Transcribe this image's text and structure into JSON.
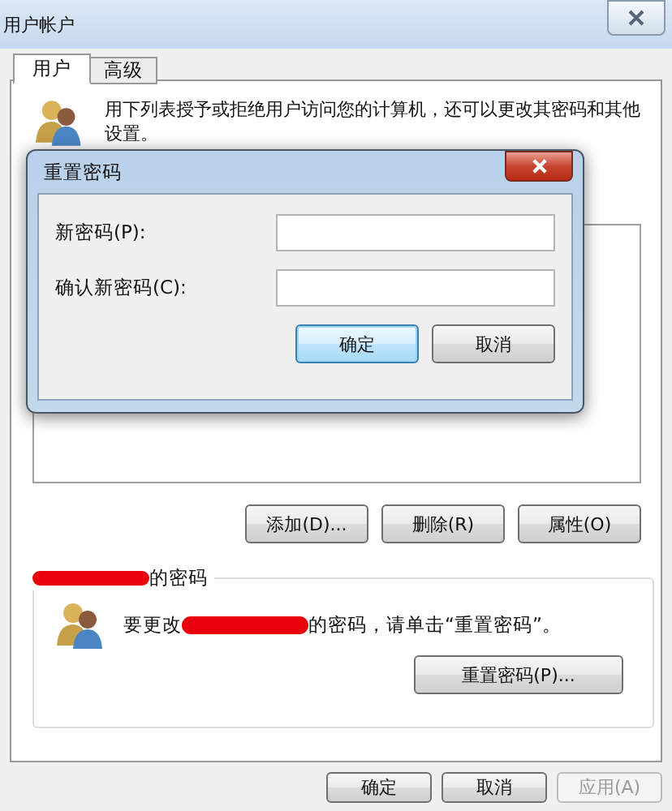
{
  "window": {
    "title": "用户帐户"
  },
  "tabs": [
    {
      "label": "用户",
      "selected": true
    },
    {
      "label": "高级",
      "selected": false
    }
  ],
  "description": "用下列表授予或拒绝用户访问您的计算机，还可以更改其密码和其他设置。",
  "user_buttons": [
    {
      "label": "添加(D)..."
    },
    {
      "label": "删除(R)"
    },
    {
      "label": "属性(O)"
    }
  ],
  "password_group": {
    "title": "的密码",
    "message_before": "要更改",
    "message_after": "的密码，请单击“重置密码”。",
    "button": "重置密码(P)..."
  },
  "footer_buttons": [
    {
      "label": "确定",
      "disabled": false
    },
    {
      "label": "取消",
      "disabled": false
    },
    {
      "label": "应用(A)",
      "disabled": true
    }
  ],
  "dialog": {
    "title": "重置密码",
    "fields": [
      {
        "label": "新密码(P):"
      },
      {
        "label": "确认新密码(C):"
      }
    ],
    "buttons": [
      {
        "label": "确定",
        "default": true
      },
      {
        "label": "取消",
        "default": false
      }
    ]
  }
}
